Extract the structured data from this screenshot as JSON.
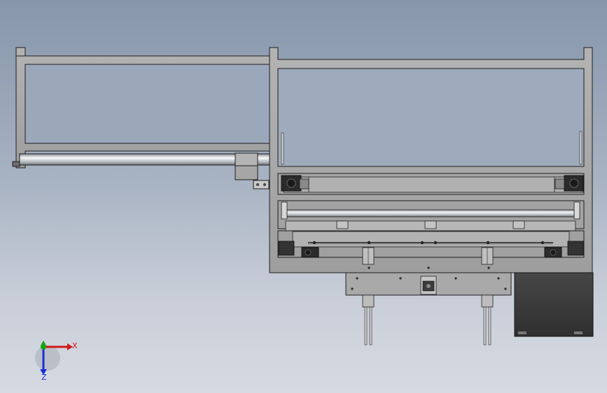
{
  "viewport": {
    "background_top": "#8796ab",
    "background_bottom": "#d6dae2"
  },
  "model": {
    "frame_color": "#a8a8a8",
    "outline_color": "#1e1e1e",
    "rod_color": "#d9dde2",
    "motor_color": "#2b2b2b",
    "cabinet_color": "#3c3c3c"
  },
  "triad": {
    "x_label": "X",
    "z_label": "Z",
    "x_color": "#d11a1a",
    "y_color": "#16a316",
    "z_color": "#1a2fd1"
  }
}
